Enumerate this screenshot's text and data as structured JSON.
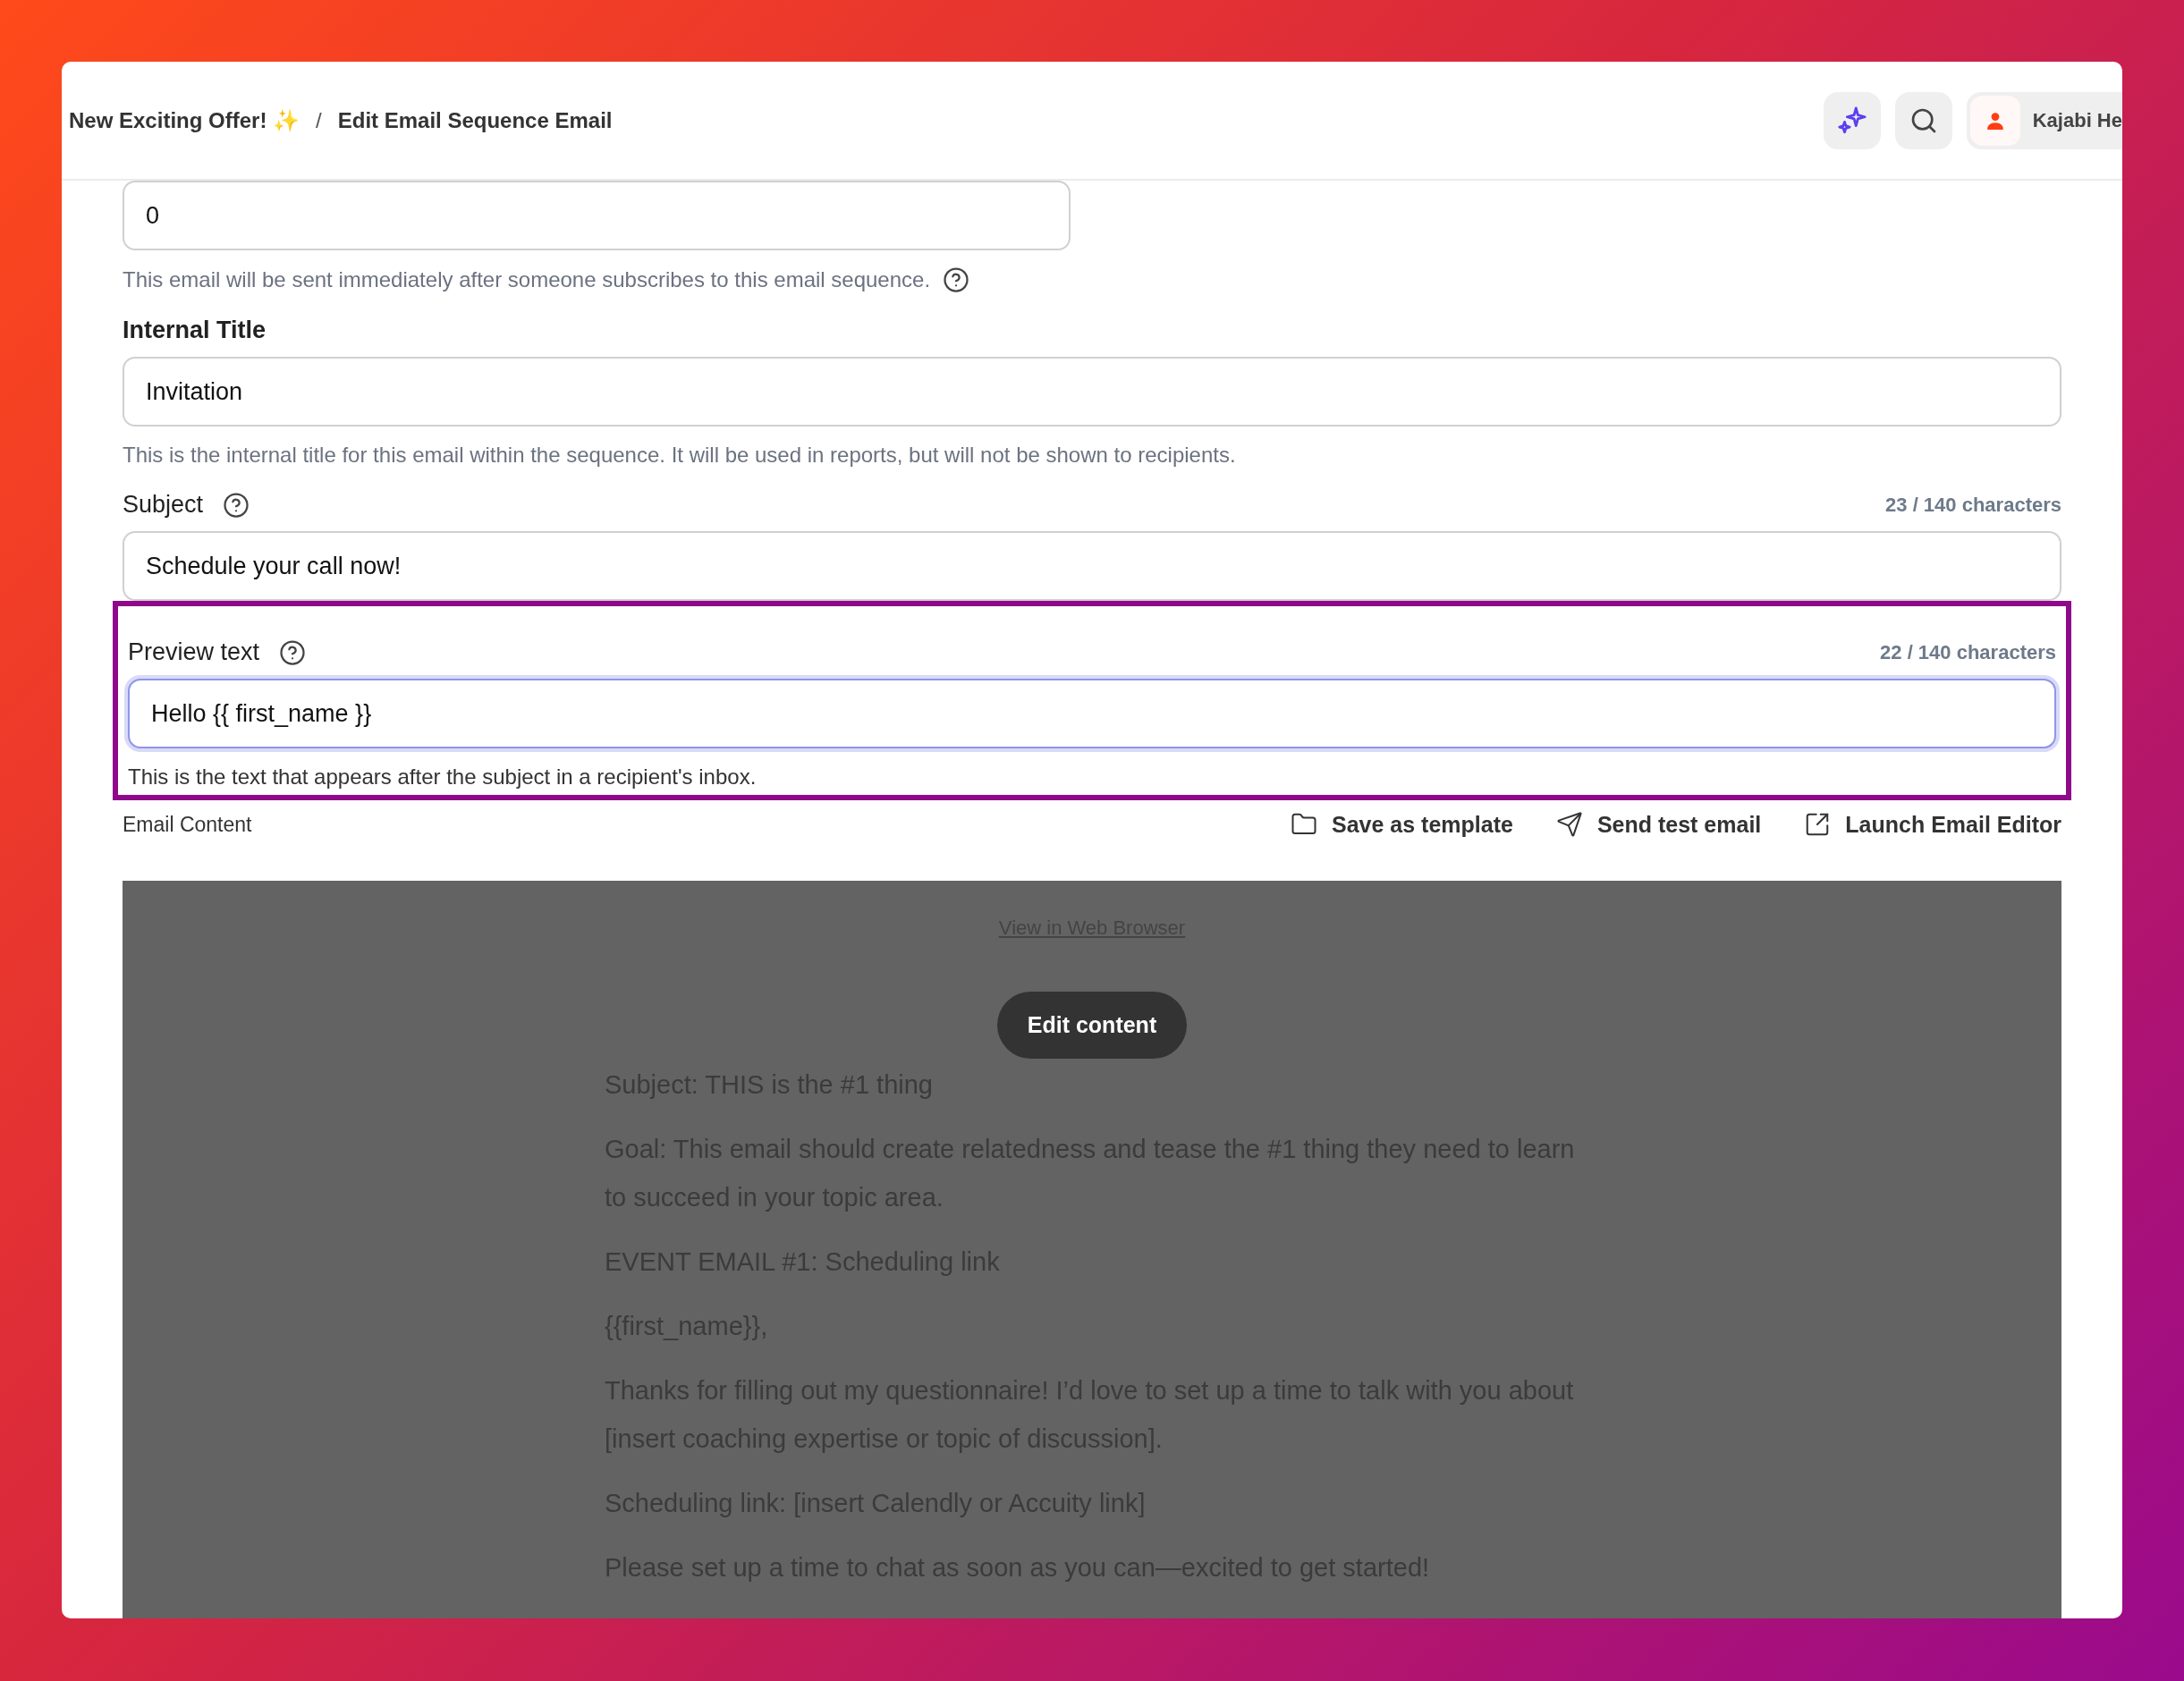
{
  "breadcrumb": {
    "items": [
      "New Exciting Offer! ✨",
      "Edit Email Sequence Email"
    ],
    "separator": "/"
  },
  "header": {
    "user_name": "Kajabi He"
  },
  "form": [
    {
      "kind": "delay",
      "value": "0",
      "help": "This email will be sent immediately after someone subscribes to this email sequence.",
      "focused": false,
      "highlighted": false
    },
    {
      "kind": "plain",
      "label": "Internal Title",
      "value": "Invitation",
      "help": "This is the internal title for this email within the sequence. It will be used in reports, but will not be shown to recipients.",
      "focused": false,
      "highlighted": false
    },
    {
      "kind": "counted",
      "label": "Subject",
      "value": "Schedule your call now!",
      "counter": "23 / 140 characters",
      "focused": false,
      "highlighted": false
    },
    {
      "kind": "counted",
      "label": "Preview text",
      "value": "Hello {{ first_name }}",
      "counter": "22 / 140 characters",
      "help": "This is the text that appears after the subject in a recipient's inbox.",
      "focused": true,
      "highlighted": true
    }
  ],
  "email_content": {
    "label": "Email Content",
    "actions": [
      {
        "kind": "folder",
        "label": "Save as template"
      },
      {
        "kind": "send",
        "label": "Send test email"
      },
      {
        "kind": "external",
        "label": "Launch Email Editor"
      }
    ],
    "preview": {
      "link": "View in Web Browser",
      "edit_button": "Edit content",
      "paragraphs": [
        "Subject: THIS is the #1 thing",
        "Goal: This email should create relatedness and tease the #1 thing they need to learn to succeed in your topic area.",
        "EVENT EMAIL #1: Scheduling link",
        "{{first_name}},",
        "Thanks for filling out my questionnaire! I’d love to set up a time to talk with you about [insert coaching expertise or topic of discussion].",
        "Scheduling link: [insert Calendly or Accuity link]",
        "Please set up a time to chat as soon as you can—excited to get started!"
      ]
    }
  }
}
